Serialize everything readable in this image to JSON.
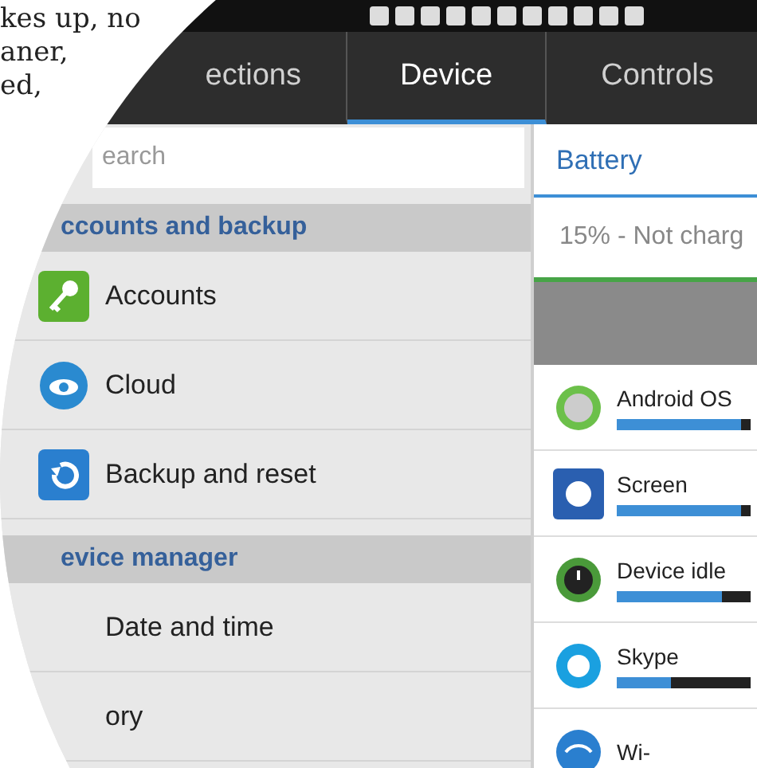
{
  "article_text": [
    "kes up, no",
    "aner,",
    "ed,"
  ],
  "tabs": [
    {
      "label": "ections",
      "selected": false
    },
    {
      "label": "Device",
      "selected": true
    },
    {
      "label": "Controls",
      "selected": false
    }
  ],
  "search": {
    "placeholder": "earch"
  },
  "sections": [
    {
      "title": "ccounts and backup",
      "items": [
        {
          "label": "Accounts"
        },
        {
          "label": "Cloud"
        },
        {
          "label": "Backup and reset"
        }
      ]
    },
    {
      "title": "evice manager",
      "items": [
        {
          "label": "Date and time"
        },
        {
          "label": "ory"
        }
      ]
    }
  ],
  "battery": {
    "title": "Battery",
    "status": "15% - Not charg",
    "apps": [
      {
        "name": "Android OS",
        "level": 0.93
      },
      {
        "name": "Screen",
        "level": 0.93
      },
      {
        "name": "Device idle",
        "level": 0.78
      },
      {
        "name": "Skype",
        "level": 0.4
      },
      {
        "name": "Wi-"
      }
    ]
  }
}
